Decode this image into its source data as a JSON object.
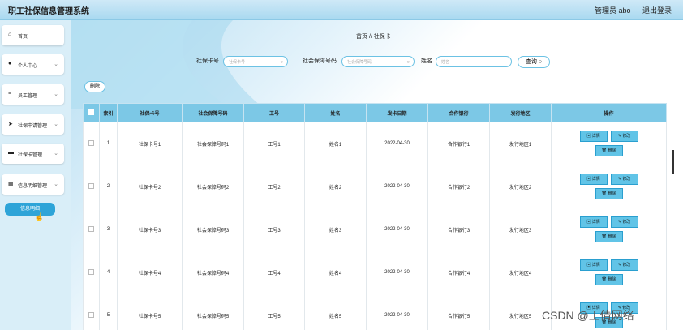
{
  "header": {
    "title": "职工社保信息管理系统",
    "user": "管理员 abo",
    "logout": "退出登录"
  },
  "sidebar": {
    "items": [
      {
        "label": "首页",
        "icon": "home-icon"
      },
      {
        "label": "个人中心",
        "icon": "user-icon"
      },
      {
        "label": "员工管理",
        "icon": "staff-icon"
      },
      {
        "label": "社保申请管理",
        "icon": "send-icon"
      },
      {
        "label": "社保卡管理",
        "icon": "card-icon"
      },
      {
        "label": "信息明细管理",
        "icon": "grid-icon"
      }
    ],
    "sub_item": "信息明细"
  },
  "breadcrumb": {
    "home": "首页",
    "sep": "//",
    "current": "社保卡"
  },
  "search": {
    "card_label": "社保卡号",
    "card_placeholder": "社保卡号",
    "sin_label": "社会保障号码",
    "sin_placeholder": "社会保障号码",
    "name_label": "姓名",
    "name_placeholder": "姓名",
    "button": "查询"
  },
  "toolbar": {
    "delete": "删除"
  },
  "table": {
    "headers": [
      "索引",
      "社保卡号",
      "社会保障号码",
      "工号",
      "姓名",
      "发卡日期",
      "合作银行",
      "发行地区",
      "操作"
    ],
    "rows": [
      [
        "1",
        "社保卡号1",
        "社会保障号码1",
        "工号1",
        "姓名1",
        "2022-04-30",
        "合作银行1",
        "发行地区1"
      ],
      [
        "2",
        "社保卡号2",
        "社会保障号码2",
        "工号2",
        "姓名2",
        "2022-04-30",
        "合作银行2",
        "发行地区2"
      ],
      [
        "3",
        "社保卡号3",
        "社会保障号码3",
        "工号3",
        "姓名3",
        "2022-04-30",
        "合作银行3",
        "发行地区3"
      ],
      [
        "4",
        "社保卡号4",
        "社会保障号码4",
        "工号4",
        "姓名4",
        "2022-04-30",
        "合作银行4",
        "发行地区4"
      ],
      [
        "5",
        "社保卡号5",
        "社会保障号码5",
        "工号5",
        "姓名5",
        "2022-04-30",
        "合作银行5",
        "发行地区5"
      ]
    ],
    "actions": {
      "detail": "详情",
      "edit": "修改",
      "delete": "删除"
    }
  },
  "watermark": "CSDN @王倩网络",
  "colors": {
    "accent": "#2ea4d8",
    "header_bg": "#a9d9f0",
    "table_header": "#7cc8e6"
  }
}
